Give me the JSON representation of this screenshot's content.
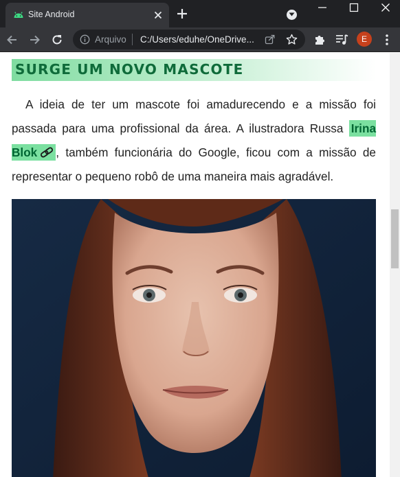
{
  "browser": {
    "tab_title": "Site Android",
    "address_scheme_label": "Arquivo",
    "address_url": "C:/Users/eduhe/OneDrive...",
    "profile_initial": "E",
    "accent_color": "#3ddc84"
  },
  "article": {
    "section_title": "SURGE UM NOVO MASCOTE",
    "paragraph_before_link": "A ideia de ter um mascote foi amadurecendo e a missão foi passada para uma profissional da área. A ilustradora Russa ",
    "link_text": "Irina Blok",
    "paragraph_after_link": ", também funcionária do Google, ficou com a missão de representar o pequeno robô de uma maneira mais agradável.",
    "highlight_color": "#7be0a0",
    "title_text_color": "#0f6b3a"
  },
  "icons": {
    "favicon": "android-icon",
    "link": "link-chain-icon",
    "profile": "avatar"
  }
}
